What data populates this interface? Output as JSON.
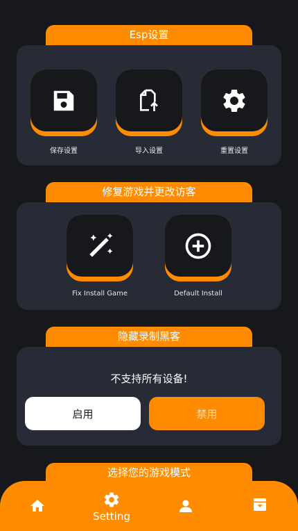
{
  "sections": {
    "esp": {
      "title": "Esp设置"
    },
    "fix": {
      "title": "修复游戏并更改访客"
    },
    "hide": {
      "title": "隐藏录制黑客"
    },
    "mode": {
      "title": "选择您的游戏模式"
    }
  },
  "esp_tiles": [
    {
      "label": "保存设置",
      "icon": "save-icon"
    },
    {
      "label": "导入设置",
      "icon": "import-file-icon"
    },
    {
      "label": "重置设置",
      "icon": "gear-icon"
    }
  ],
  "fix_tiles": [
    {
      "label": "Fix Install Game",
      "icon": "magic-wand-icon"
    },
    {
      "label": "Default Install",
      "icon": "plus-circle-icon"
    }
  ],
  "hide": {
    "notice": "不支持所有设备!",
    "enable_label": "启用",
    "disable_label": "禁用"
  },
  "nav": {
    "home_icon": "home-icon",
    "setting_label": "Setting",
    "profile_icon": "user-icon",
    "archive_icon": "archive-icon"
  },
  "colors": {
    "accent": "#ff8c00",
    "background": "#16181c",
    "card": "#262b35"
  }
}
